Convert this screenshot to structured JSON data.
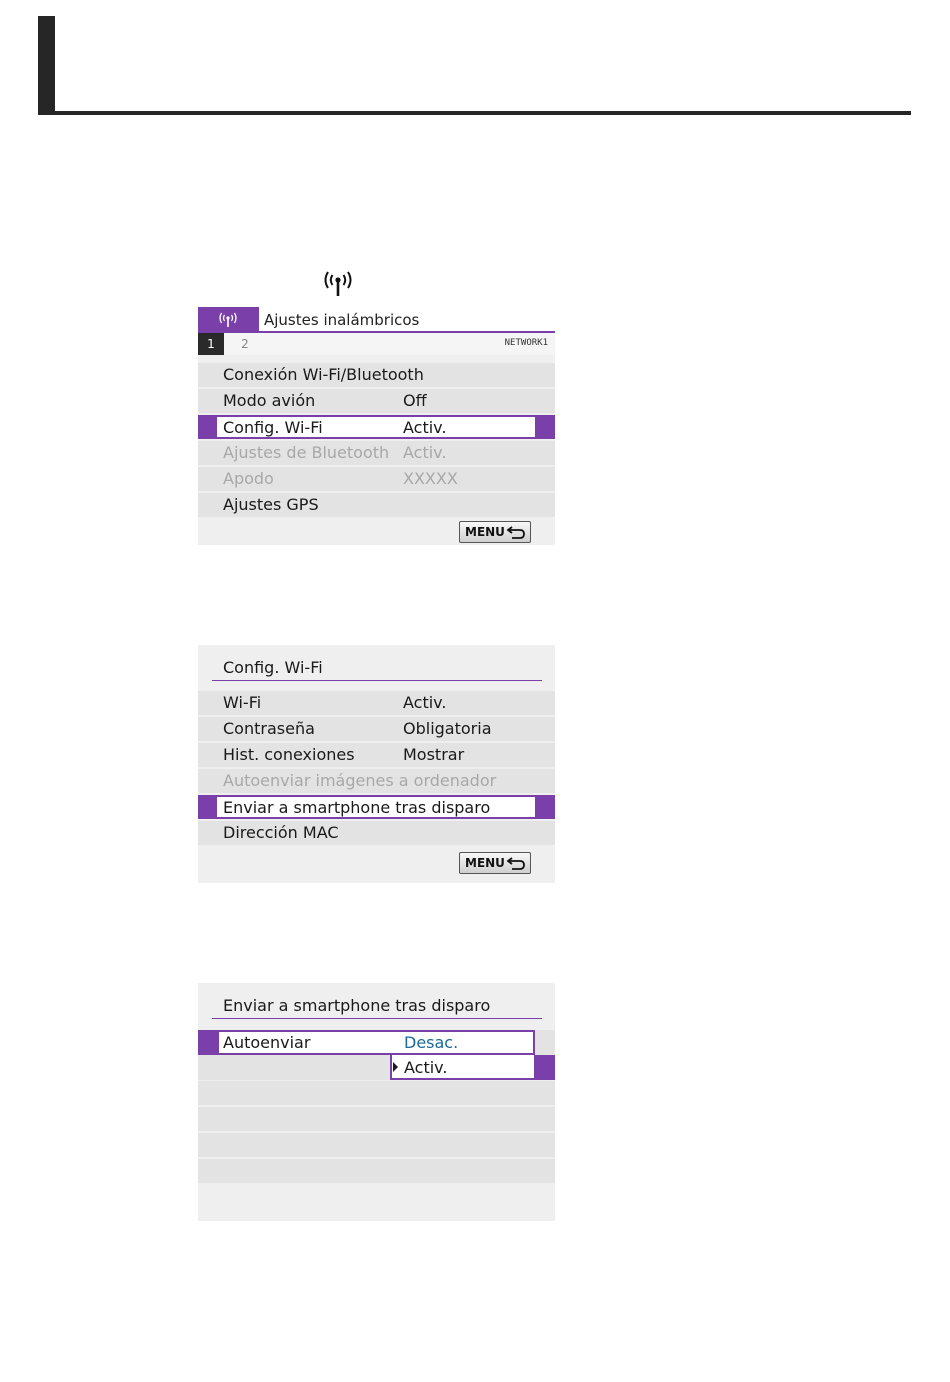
{
  "colors": {
    "accent": "#7a3fa8",
    "row_bg": "#e3e3e3",
    "dim_text": "#a8a8a8",
    "value_blue": "#1a6a9a"
  },
  "wireless_icon": "wireless-antenna-icon",
  "screen1": {
    "title": "Ajustes inalámbricos",
    "tabs": [
      "1",
      "2"
    ],
    "network_label": "NETWORK1",
    "rows": [
      {
        "label": "Conexión Wi-Fi/Bluetooth",
        "value": ""
      },
      {
        "label": "Modo avión",
        "value": "Off"
      },
      {
        "label": "Config. Wi-Fi",
        "value": "Activ."
      },
      {
        "label": "Ajustes de Bluetooth",
        "value": "Activ."
      },
      {
        "label": "Apodo",
        "value": "XXXXX"
      },
      {
        "label": "Ajustes GPS",
        "value": ""
      }
    ],
    "menu_button": "MENU"
  },
  "screen2": {
    "title": "Config. Wi-Fi",
    "rows": [
      {
        "label": "Wi-Fi",
        "value": "Activ."
      },
      {
        "label": "Contraseña",
        "value": "Obligatoria"
      },
      {
        "label": "Hist. conexiones",
        "value": "Mostrar"
      },
      {
        "label": "Autoenviar imágenes a ordenador",
        "value": ""
      },
      {
        "label": "Enviar a smartphone tras disparo",
        "value": ""
      },
      {
        "label": "Dirección MAC",
        "value": ""
      }
    ],
    "menu_button": "MENU"
  },
  "screen3": {
    "title": "Enviar a smartphone tras disparo",
    "setting_label": "Autoenviar",
    "options": [
      "Desac.",
      "Activ."
    ]
  }
}
